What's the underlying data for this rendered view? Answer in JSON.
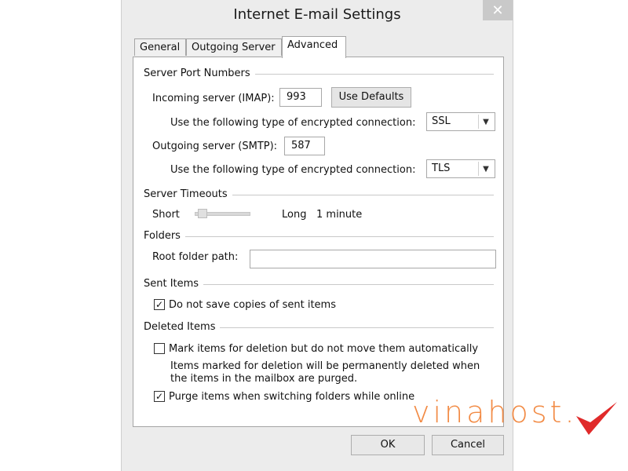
{
  "window": {
    "title": "Internet E-mail Settings",
    "close_glyph": "✕"
  },
  "tabs": [
    {
      "label": "General"
    },
    {
      "label": "Outgoing Server"
    },
    {
      "label": "Advanced"
    }
  ],
  "active_tab": "Advanced",
  "server_ports": {
    "section_label": "Server Port Numbers",
    "incoming_label": "Incoming server (IMAP):",
    "incoming_value": "993",
    "use_defaults_label": "Use Defaults",
    "incoming_encryption_label": "Use the following type of encrypted connection:",
    "incoming_encryption_value": "SSL",
    "outgoing_label": "Outgoing server (SMTP):",
    "outgoing_value": "587",
    "outgoing_encryption_label": "Use the following type of encrypted connection:",
    "outgoing_encryption_value": "TLS"
  },
  "timeouts": {
    "section_label": "Server Timeouts",
    "short_label": "Short",
    "long_label": "Long",
    "value_text": "1 minute"
  },
  "folders": {
    "section_label": "Folders",
    "root_label": "Root folder path:",
    "root_value": ""
  },
  "sent_items": {
    "section_label": "Sent Items",
    "dont_save_label": "Do not save copies of sent items",
    "dont_save_checked": true
  },
  "deleted_items": {
    "section_label": "Deleted Items",
    "mark_label": "Mark items for deletion but do not move them automatically",
    "mark_checked": false,
    "info_line1": "Items marked for deletion will be permanently deleted when",
    "info_line2": "the items in the mailbox are purged.",
    "purge_label": "Purge items when switching folders while online",
    "purge_checked": true
  },
  "buttons": {
    "ok": "OK",
    "cancel": "Cancel"
  },
  "watermark": {
    "text": "vinahost.",
    "color": "#f28b45",
    "check_color": "#e02a2a"
  }
}
